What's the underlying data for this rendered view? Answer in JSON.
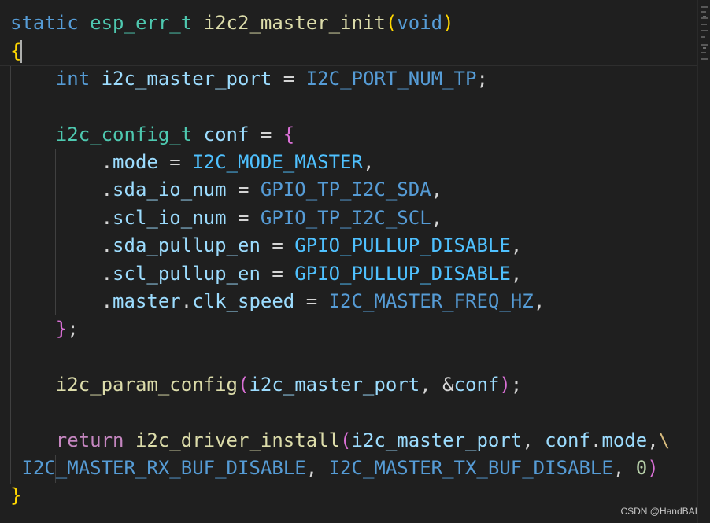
{
  "code": {
    "l1": {
      "a": "static",
      "b": " ",
      "c": "esp_err_t",
      "d": " ",
      "e": "i2c2_master_init",
      "f": "(",
      "g": "void",
      "h": ")"
    },
    "l2": {
      "a": "{"
    },
    "l3": {
      "a": "    ",
      "b": "int",
      "c": " ",
      "d": "i2c_master_port",
      "e": " = ",
      "f": "I2C_PORT_NUM_TP",
      "g": ";"
    },
    "l5": {
      "a": "    ",
      "b": "i2c_config_t",
      "c": " ",
      "d": "conf",
      "e": " = ",
      "f": "{"
    },
    "l6": {
      "a": "        .",
      "b": "mode",
      "c": " = ",
      "d": "I2C_MODE_MASTER",
      "e": ","
    },
    "l7": {
      "a": "        .",
      "b": "sda_io_num",
      "c": " = ",
      "d": "GPIO_TP_I2C_SDA",
      "e": ","
    },
    "l8": {
      "a": "        .",
      "b": "scl_io_num",
      "c": " = ",
      "d": "GPIO_TP_I2C_SCL",
      "e": ","
    },
    "l9": {
      "a": "        .",
      "b": "sda_pullup_en",
      "c": " = ",
      "d": "GPIO_PULLUP_DISABLE",
      "e": ","
    },
    "l10": {
      "a": "        .",
      "b": "scl_pullup_en",
      "c": " = ",
      "d": "GPIO_PULLUP_DISABLE",
      "e": ","
    },
    "l11": {
      "a": "        .",
      "b": "master",
      "c": ".",
      "d": "clk_speed",
      "e": " = ",
      "f": "I2C_MASTER_FREQ_HZ",
      "g": ","
    },
    "l12": {
      "a": "    ",
      "b": "}",
      "c": ";"
    },
    "l14": {
      "a": "    ",
      "b": "i2c_param_config",
      "c": "(",
      "d": "i2c_master_port",
      "e": ", &",
      "f": "conf",
      "g": ")",
      "h": ";"
    },
    "l16": {
      "a": "    ",
      "b": "return",
      "c": " ",
      "d": "i2c_driver_install",
      "e": "(",
      "f": "i2c_master_port",
      "g": ", ",
      "h": "conf",
      "i": ".",
      "j": "mode",
      "k": ",",
      "l": "\\"
    },
    "l17": {
      "a": " ",
      "b": "I2C_MASTER_RX_BUF_DISABLE",
      "c": ", ",
      "d": "I2C_MASTER_TX_BUF_DISABLE",
      "e": ", ",
      "f": "0",
      "g": ")"
    },
    "l18": {
      "a": "}"
    }
  },
  "watermark": "CSDN @HandBAI"
}
